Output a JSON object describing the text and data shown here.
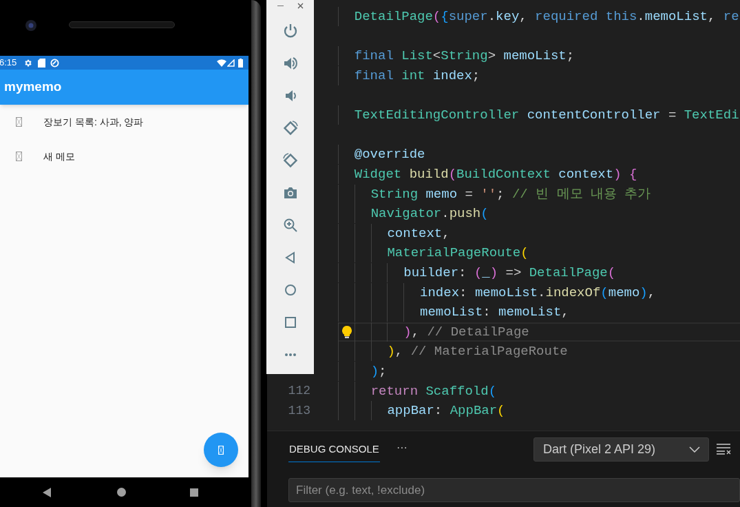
{
  "phone": {
    "status_bar": {
      "time": "6:15"
    },
    "app_bar": {
      "title": "mymemo"
    },
    "memos": [
      {
        "text": "장보기 목록: 사과, 양파"
      },
      {
        "text": "새 메모"
      }
    ]
  },
  "editor": {
    "lines": [
      {
        "current": false,
        "tokens": [
          {
            "text": "  DetailPage",
            "kind": "type"
          },
          {
            "text": "(",
            "kind": "b2"
          },
          {
            "text": "{",
            "kind": "b3"
          },
          {
            "text": "super",
            "kind": "keyword"
          },
          {
            "text": ".",
            "kind": "plain"
          },
          {
            "text": "key",
            "kind": "var"
          },
          {
            "text": ", ",
            "kind": "plain"
          },
          {
            "text": "required this",
            "kind": "keyword"
          },
          {
            "text": ".",
            "kind": "plain"
          },
          {
            "text": "memoList",
            "kind": "var"
          },
          {
            "text": ", ",
            "kind": "plain"
          },
          {
            "text": "re",
            "kind": "keyword"
          }
        ]
      },
      {
        "current": false
      },
      {
        "current": false,
        "tokens": [
          {
            "text": "  final ",
            "kind": "keyword"
          },
          {
            "text": "List",
            "kind": "type"
          },
          {
            "text": "<",
            "kind": "plain"
          },
          {
            "text": "String",
            "kind": "type"
          },
          {
            "text": "> ",
            "kind": "plain"
          },
          {
            "text": "memoList",
            "kind": "var"
          },
          {
            "text": ";",
            "kind": "plain"
          }
        ]
      },
      {
        "current": false,
        "tokens": [
          {
            "text": "  final ",
            "kind": "keyword"
          },
          {
            "text": "int ",
            "kind": "type"
          },
          {
            "text": "index",
            "kind": "var"
          },
          {
            "text": ";",
            "kind": "plain"
          }
        ]
      },
      {
        "current": false
      },
      {
        "current": false,
        "tokens": [
          {
            "text": "  TextEditingController ",
            "kind": "type"
          },
          {
            "text": "contentController",
            "kind": "var"
          },
          {
            "text": " = ",
            "kind": "plain"
          },
          {
            "text": "TextEdi",
            "kind": "type"
          }
        ]
      },
      {
        "current": false
      },
      {
        "current": false,
        "tokens": [
          {
            "text": "  @override",
            "kind": "var"
          }
        ]
      },
      {
        "current": false,
        "tokens": [
          {
            "text": "  Widget ",
            "kind": "type"
          },
          {
            "text": "build",
            "kind": "func"
          },
          {
            "text": "(",
            "kind": "b2"
          },
          {
            "text": "BuildContext ",
            "kind": "type"
          },
          {
            "text": "context",
            "kind": "var"
          },
          {
            "text": ")",
            "kind": "b2"
          },
          {
            "text": " {",
            "kind": "b2"
          }
        ]
      },
      {
        "current": false,
        "tokens": [
          {
            "text": "    String ",
            "kind": "type"
          },
          {
            "text": "memo",
            "kind": "var"
          },
          {
            "text": " = ",
            "kind": "plain"
          },
          {
            "text": "''",
            "kind": "string"
          },
          {
            "text": "; ",
            "kind": "plain"
          },
          {
            "text": "// 빈 메모 내용 추가",
            "kind": "comment"
          }
        ]
      },
      {
        "current": false,
        "tokens": [
          {
            "text": "    Navigator",
            "kind": "type"
          },
          {
            "text": ".",
            "kind": "plain"
          },
          {
            "text": "push",
            "kind": "func"
          },
          {
            "text": "(",
            "kind": "b3"
          }
        ]
      },
      {
        "current": false,
        "tokens": [
          {
            "text": "      context",
            "kind": "var"
          },
          {
            "text": ",",
            "kind": "plain"
          }
        ]
      },
      {
        "current": false,
        "tokens": [
          {
            "text": "      MaterialPageRoute",
            "kind": "type"
          },
          {
            "text": "(",
            "kind": "b1"
          }
        ]
      },
      {
        "current": false,
        "tokens": [
          {
            "text": "        builder",
            "kind": "var"
          },
          {
            "text": ": ",
            "kind": "plain"
          },
          {
            "text": "(",
            "kind": "b2"
          },
          {
            "text": "_",
            "kind": "var"
          },
          {
            "text": ")",
            "kind": "b2"
          },
          {
            "text": " => ",
            "kind": "plain"
          },
          {
            "text": "DetailPage",
            "kind": "type"
          },
          {
            "text": "(",
            "kind": "b2"
          }
        ]
      },
      {
        "current": false,
        "tokens": [
          {
            "text": "          index",
            "kind": "var"
          },
          {
            "text": ": ",
            "kind": "plain"
          },
          {
            "text": "memoList",
            "kind": "var"
          },
          {
            "text": ".",
            "kind": "plain"
          },
          {
            "text": "indexOf",
            "kind": "func"
          },
          {
            "text": "(",
            "kind": "b3"
          },
          {
            "text": "memo",
            "kind": "var"
          },
          {
            "text": ")",
            "kind": "b3"
          },
          {
            "text": ",",
            "kind": "plain"
          }
        ]
      },
      {
        "current": false,
        "tokens": [
          {
            "text": "          memoList",
            "kind": "var"
          },
          {
            "text": ": ",
            "kind": "plain"
          },
          {
            "text": "memoList",
            "kind": "var"
          },
          {
            "text": ",",
            "kind": "plain"
          }
        ]
      },
      {
        "current": true,
        "tokens": [
          {
            "text": "        )",
            "kind": "b2"
          },
          {
            "text": ", ",
            "kind": "plain"
          },
          {
            "text": "// DetailPage",
            "kind": "hint"
          }
        ]
      },
      {
        "current": false,
        "tokens": [
          {
            "text": "      )",
            "kind": "b1"
          },
          {
            "text": ", ",
            "kind": "plain"
          },
          {
            "text": "// MaterialPageRoute",
            "kind": "hint"
          }
        ]
      },
      {
        "current": false,
        "tokens": [
          {
            "text": "    )",
            "kind": "b3"
          },
          {
            "text": ";",
            "kind": "plain"
          }
        ]
      },
      {
        "current": false,
        "number": "112",
        "tokens": [
          {
            "text": "    return ",
            "kind": "control"
          },
          {
            "text": "Scaffold",
            "kind": "type"
          },
          {
            "text": "(",
            "kind": "b3"
          }
        ]
      },
      {
        "current": false,
        "number": "113",
        "tokens": [
          {
            "text": "      appBar",
            "kind": "var"
          },
          {
            "text": ": ",
            "kind": "plain"
          },
          {
            "text": "AppBar",
            "kind": "type"
          },
          {
            "text": "(",
            "kind": "b1"
          }
        ]
      }
    ]
  },
  "panel": {
    "tabs": [
      {
        "label": "DEBUG CONSOLE",
        "selected": true
      }
    ],
    "more": "···",
    "session": "Dart (Pixel 2 API 29)",
    "filter": {
      "placeholder": "Filter (e.g. text, !exclude)"
    }
  }
}
